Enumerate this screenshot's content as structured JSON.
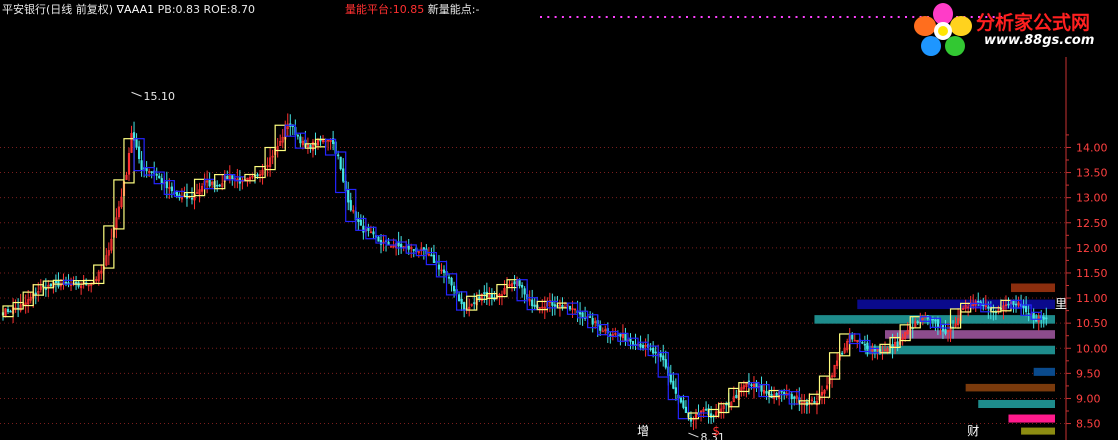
{
  "header": {
    "stock_name": "平安银行(日线 前复权)",
    "indicator_marker": "∇",
    "indicator_name": "AAA1",
    "pb_label": "PB:",
    "pb_value": "0.83",
    "roe_label": "ROE:",
    "roe_value": "8.70",
    "platform_label": "量能平台:",
    "platform_value": "10.85",
    "new_point_label": "新量能点:",
    "new_point_value": "-"
  },
  "logo": {
    "brand": "分析家公式网",
    "url": "www.88gs.com"
  },
  "chart_data": {
    "type": "candlestick",
    "title": "",
    "ylim": [
      8.3,
      15.15
    ],
    "y_ticks": [
      "8.50",
      "9.00",
      "9.50",
      "10.00",
      "10.50",
      "11.00",
      "11.50",
      "12.00",
      "12.50",
      "13.00",
      "13.50",
      "14.00"
    ],
    "grid": true,
    "grid_style": "dotted-red",
    "annotations": [
      {
        "text": "15.10",
        "index": 51,
        "value": 15.1
      },
      {
        "text": "8.31",
        "index": 272,
        "value": 8.31
      }
    ],
    "bottom_markers": [
      {
        "text": "增",
        "index": 254,
        "color": "#ffffff"
      },
      {
        "text": "$",
        "index": 283,
        "color": "#ff3030"
      },
      {
        "text": "财",
        "index": 385,
        "color": "#ffffff"
      }
    ],
    "right_label": "里",
    "keyframes": [
      [
        0,
        10.72
      ],
      [
        8,
        10.85
      ],
      [
        15,
        11.2
      ],
      [
        22,
        11.28
      ],
      [
        30,
        11.25
      ],
      [
        36,
        11.33
      ],
      [
        40,
        11.6
      ],
      [
        45,
        12.6
      ],
      [
        49,
        13.5
      ],
      [
        51,
        14.3
      ],
      [
        55,
        13.6
      ],
      [
        60,
        13.5
      ],
      [
        65,
        13.2
      ],
      [
        70,
        13.0
      ],
      [
        75,
        13.0
      ],
      [
        80,
        13.3
      ],
      [
        85,
        13.25
      ],
      [
        90,
        13.45
      ],
      [
        95,
        13.3
      ],
      [
        100,
        13.4
      ],
      [
        105,
        13.7
      ],
      [
        110,
        14.1
      ],
      [
        113,
        14.5
      ],
      [
        116,
        14.3
      ],
      [
        120,
        14.0
      ],
      [
        125,
        14.1
      ],
      [
        130,
        14.2
      ],
      [
        133,
        13.8
      ],
      [
        135,
        13.3
      ],
      [
        138,
        12.8
      ],
      [
        142,
        12.4
      ],
      [
        145,
        12.3
      ],
      [
        150,
        12.1
      ],
      [
        155,
        12.05
      ],
      [
        160,
        12.0
      ],
      [
        165,
        11.95
      ],
      [
        170,
        11.8
      ],
      [
        175,
        11.5
      ],
      [
        180,
        11.1
      ],
      [
        183,
        10.75
      ],
      [
        186,
        10.85
      ],
      [
        190,
        11.1
      ],
      [
        195,
        11.0
      ],
      [
        200,
        11.2
      ],
      [
        205,
        11.3
      ],
      [
        208,
        10.95
      ],
      [
        212,
        10.85
      ],
      [
        217,
        10.9
      ],
      [
        222,
        10.85
      ],
      [
        227,
        10.75
      ],
      [
        232,
        10.6
      ],
      [
        237,
        10.4
      ],
      [
        242,
        10.3
      ],
      [
        247,
        10.2
      ],
      [
        252,
        10.1
      ],
      [
        257,
        9.95
      ],
      [
        262,
        9.75
      ],
      [
        266,
        9.2
      ],
      [
        270,
        8.8
      ],
      [
        273,
        8.5
      ],
      [
        277,
        8.75
      ],
      [
        282,
        8.65
      ],
      [
        286,
        8.8
      ],
      [
        290,
        9.0
      ],
      [
        295,
        9.3
      ],
      [
        300,
        9.2
      ],
      [
        305,
        9.05
      ],
      [
        310,
        9.1
      ],
      [
        315,
        9.0
      ],
      [
        320,
        8.9
      ],
      [
        324,
        9.0
      ],
      [
        328,
        9.4
      ],
      [
        332,
        9.85
      ],
      [
        336,
        10.2
      ],
      [
        340,
        10.1
      ],
      [
        345,
        10.0
      ],
      [
        350,
        9.95
      ],
      [
        355,
        10.1
      ],
      [
        360,
        10.4
      ],
      [
        365,
        10.6
      ],
      [
        370,
        10.5
      ],
      [
        375,
        10.3
      ],
      [
        380,
        10.7
      ],
      [
        385,
        10.95
      ],
      [
        390,
        10.85
      ],
      [
        395,
        10.75
      ],
      [
        400,
        10.9
      ],
      [
        403,
        10.85
      ],
      [
        406,
        10.7
      ],
      [
        410,
        10.6
      ],
      [
        414,
        10.58
      ]
    ],
    "volume_platforms": [
      {
        "low": 10.78,
        "high": 10.97,
        "color": "#0a0a8c",
        "start_index": 339
      },
      {
        "low": 10.49,
        "high": 10.66,
        "color": "#1e8c8c",
        "start_index": 322
      },
      {
        "low": 10.19,
        "high": 10.36,
        "color": "#8c4c8c",
        "start_index": 350
      },
      {
        "low": 9.88,
        "high": 10.05,
        "color": "#1e8c8c",
        "start_index": 342
      },
      {
        "low": 11.12,
        "high": 11.29,
        "color": "#8c2e0e",
        "start_index": 400
      },
      {
        "low": 9.45,
        "high": 9.61,
        "color": "#0a4a8c",
        "start_index": 409
      },
      {
        "low": 9.14,
        "high": 9.29,
        "color": "#7a3a0c",
        "start_index": 382
      },
      {
        "low": 8.81,
        "high": 8.97,
        "color": "#1e8c8c",
        "start_index": 387
      },
      {
        "low": 8.52,
        "high": 8.68,
        "color": "#ff1a8c",
        "start_index": 399
      },
      {
        "low": 8.28,
        "high": 8.42,
        "color": "#8c8c12",
        "start_index": 404
      }
    ],
    "up_color": "#ff3232",
    "down_color": "#46e6e6",
    "trend_up_color": "#ffff80",
    "trend_down_color": "#2424ff",
    "platform_line_color": "#ff40ff"
  }
}
